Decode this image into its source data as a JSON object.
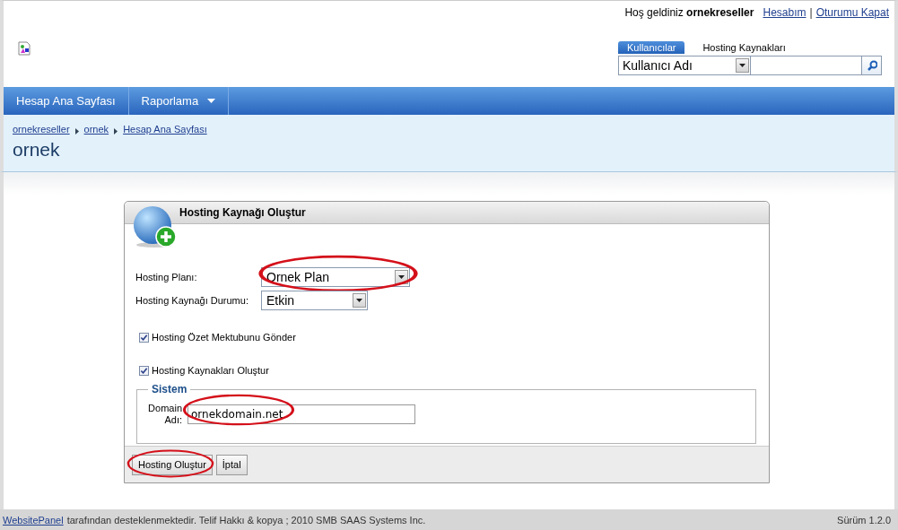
{
  "header": {
    "welcome": "Hoş geldiniz",
    "user": "ornekreseller",
    "links": [
      {
        "label": "Hesabım"
      },
      {
        "label": "Oturumu Kapat"
      }
    ],
    "separator": "|",
    "search_tabs": [
      {
        "label": "Kullanıcılar",
        "selected": true
      },
      {
        "label": "Hosting Kaynakları",
        "selected": false
      }
    ],
    "search": {
      "field_select": "Kullanıcı Adı"
    }
  },
  "nav": [
    {
      "label": "Hesap Ana Sayfası",
      "has_menu": false
    },
    {
      "label": "Raporlama",
      "has_menu": true
    }
  ],
  "breadcrumb": [
    {
      "label": "ornekreseller"
    },
    {
      "label": "ornek"
    },
    {
      "label": "Hesap Ana Sayfası"
    }
  ],
  "page_title": "ornek",
  "panel": {
    "title": "Hosting Kaynağı Oluştur",
    "fields": [
      {
        "kind": "select",
        "label": "Hosting Planı:",
        "value": "Ornek Plan",
        "wide": true,
        "highlighted": true
      },
      {
        "kind": "select",
        "label": "Hosting Kaynağı Durumu:",
        "value": "Etkin",
        "wide": false,
        "highlighted": false
      },
      {
        "kind": "checkbox",
        "label": "Hosting Özet Mektubunu Gönder",
        "checked": true
      },
      {
        "kind": "checkbox",
        "label": "Hosting Kaynakları Oluştur",
        "checked": true
      }
    ],
    "group": {
      "legend": "Sistem",
      "field_label": "Domain Adı:",
      "value": "ornekdomain.net",
      "highlighted": true
    },
    "buttons": [
      {
        "label": "Hosting Oluştur",
        "highlighted": true
      },
      {
        "label": "İptal",
        "highlighted": false
      }
    ]
  },
  "footer": {
    "link": "WebsitePanel",
    "text": "tarafından desteklenmektedir. Telif Hakkı & kopya ; 2010 SMB SAAS Systems Inc.",
    "version": "Sürüm 1.2.0"
  }
}
